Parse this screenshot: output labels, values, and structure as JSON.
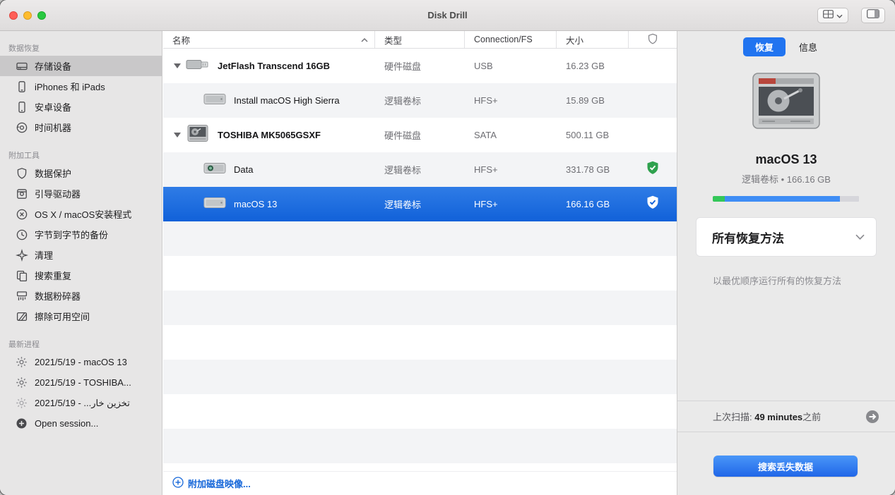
{
  "titlebar": {
    "title": "Disk Drill"
  },
  "sidebar": {
    "sections": [
      {
        "header": "数据恢复",
        "items": [
          {
            "label": "存储设备"
          },
          {
            "label": "iPhones 和 iPads"
          },
          {
            "label": "安卓设备"
          },
          {
            "label": "时间机器"
          }
        ]
      },
      {
        "header": "附加工具",
        "items": [
          {
            "label": "数据保护"
          },
          {
            "label": "引导驱动器"
          },
          {
            "label": "OS X / macOS安装程式"
          },
          {
            "label": "字节到字节的备份"
          },
          {
            "label": "清理"
          },
          {
            "label": "搜索重复"
          },
          {
            "label": "数据粉碎器"
          },
          {
            "label": "擦除可用空间"
          }
        ]
      },
      {
        "header": "最新进程",
        "items": [
          {
            "label": "2021/5/19 - macOS 13"
          },
          {
            "label": "2021/5/19 - TOSHIBA..."
          },
          {
            "label": "تخزين خار... - 2021/5/19"
          },
          {
            "label": "Open session..."
          }
        ]
      }
    ]
  },
  "table": {
    "columns": [
      "名称",
      "类型",
      "Connection/FS",
      "大小"
    ],
    "rows": [
      {
        "name": "JetFlash Transcend 16GB",
        "type": "硬件磁盘",
        "connection": "USB",
        "size": "16.23 GB"
      },
      {
        "name": "Install macOS High Sierra",
        "type": "逻辑卷标",
        "connection": "HFS+",
        "size": "15.89 GB"
      },
      {
        "name": "TOSHIBA MK5065GSXF",
        "type": "硬件磁盘",
        "connection": "SATA",
        "size": "500.11 GB"
      },
      {
        "name": "Data",
        "type": "逻辑卷标",
        "connection": "HFS+",
        "size": "331.78 GB"
      },
      {
        "name": "macOS 13",
        "type": "逻辑卷标",
        "connection": "HFS+",
        "size": "166.16 GB"
      }
    ],
    "attach_link": "附加磁盘映像..."
  },
  "inspector": {
    "tabs": [
      {
        "label": "恢复"
      },
      {
        "label": "信息"
      }
    ],
    "title": "macOS 13",
    "subtitle": "逻辑卷标 • 166.16 GB",
    "capacity_segments": [
      {
        "color": "#34c759",
        "fraction": 0.08
      },
      {
        "color": "#3f8df5",
        "fraction": 0.79
      },
      {
        "color": "#d6d6db",
        "fraction": 0.13
      }
    ],
    "method_dropdown": "所有恢复方法",
    "method_description": "以最优顺序运行所有的恢复方法",
    "last_scan_prefix": "上次扫描: ",
    "last_scan_strong": "49 minutes",
    "last_scan_suffix": "之前",
    "scan_button": "搜索丢失数据"
  },
  "colors": {
    "accent_blue": "#1667d9",
    "selected_row_blue": "#1161d9",
    "green_shield": "#2fa14e",
    "traffic_red": "#ff5f57",
    "traffic_yellow": "#febc2e",
    "traffic_green": "#28c840"
  }
}
